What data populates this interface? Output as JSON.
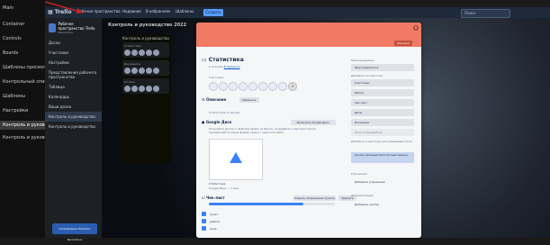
{
  "left_sidebar": {
    "items": [
      {
        "label": "Main",
        "active": false
      },
      {
        "label": "Сontainer",
        "active": false
      },
      {
        "label": "Сontrols",
        "active": false
      },
      {
        "label": "Boards",
        "active": false
      },
      {
        "label": "Шаблоны просмотра работ",
        "active": false
      },
      {
        "label": "Контрольный список",
        "active": false
      },
      {
        "label": "Шаблоны",
        "active": false
      },
      {
        "label": "Настройки",
        "active": false
      },
      {
        "label": "Контроль и руководство",
        "active": true
      },
      {
        "label": "Контроль и руководство",
        "active": false
      }
    ]
  },
  "topbar": {
    "app_name": "Trello",
    "menus": [
      "Рабочие пространства",
      "Недавние",
      "В избранном",
      "Шаблоны"
    ],
    "create_label": "Создать",
    "search_placeholder": "Поиск"
  },
  "workspace_panel": {
    "title": "Рабочее пространство Trello",
    "subtitle": "Бесплатно",
    "items": [
      {
        "label": "Доски",
        "active": false
      },
      {
        "label": "Участники",
        "active": false
      },
      {
        "label": "Настройки",
        "active": false
      },
      {
        "label": "Представления рабочего пространства",
        "active": false
      },
      {
        "label": "Таблица",
        "active": false
      },
      {
        "label": "Календарь",
        "active": false
      },
      {
        "label": "Ваши доски",
        "active": false
      },
      {
        "label": "Контроль и руководство",
        "active": true
      },
      {
        "label": "Контроль и руководство",
        "active": false
      }
    ],
    "upgrade_label": "Попробовать Premium бесплатно"
  },
  "board": {
    "title": "Контроль и руководство 2022",
    "list": {
      "title": "Контроль и руководство",
      "cards": [
        {
          "title": "Статистика",
          "avatars": 5
        },
        {
          "title": "Документы",
          "avatars": 5
        },
        {
          "title": "Отчеты",
          "avatars": 5
        }
      ]
    }
  },
  "modal": {
    "cover_button": "Обложка",
    "title": "Статистика",
    "in_list_prefix": "в колонке",
    "in_list_name": "В процессе",
    "participants_label": "Участники",
    "description_label": "Описание",
    "description_edit": "Изменить",
    "description_text": "Статистика по делам",
    "google_drive_label": "Google Диск",
    "google_drive_enable": "Включить Google Диск",
    "google_drive_text": "Получайте доступ к файлам прямо из Диска, создавайте и автоматически прикрепляйте новые файлы прямо с карточки Trello.",
    "attachment_caption": "Статистика",
    "attachment_sub": "Google Диск — 1 мин",
    "checklist_label": "Чек-лист",
    "checklist_hide": "Скрыть отмеченные пункты",
    "checklist_delete": "Удалить",
    "checklist_progress": 75,
    "checklist_items": [
      "пункт",
      "работа",
      "иное"
    ]
  },
  "modal_sidebar": {
    "suggested_label": "Рекомендуемые",
    "join_button": "Присоединиться",
    "add_to_card_label": "Добавить на карточку",
    "add_buttons": [
      "Участники",
      "Метки",
      "Чек-лист",
      "Даты",
      "Вложение",
      "Поля пользователя"
    ],
    "custom_fields_text": "Добавьте в карточки настраиваемые поля",
    "premium_button": "Начать пробный бесплатный период",
    "powerups_label": "Улучшения",
    "add_powerups": "Добавить улучшения",
    "automation_label": "Автоматизация",
    "add_button": "Добавить кнопку"
  }
}
